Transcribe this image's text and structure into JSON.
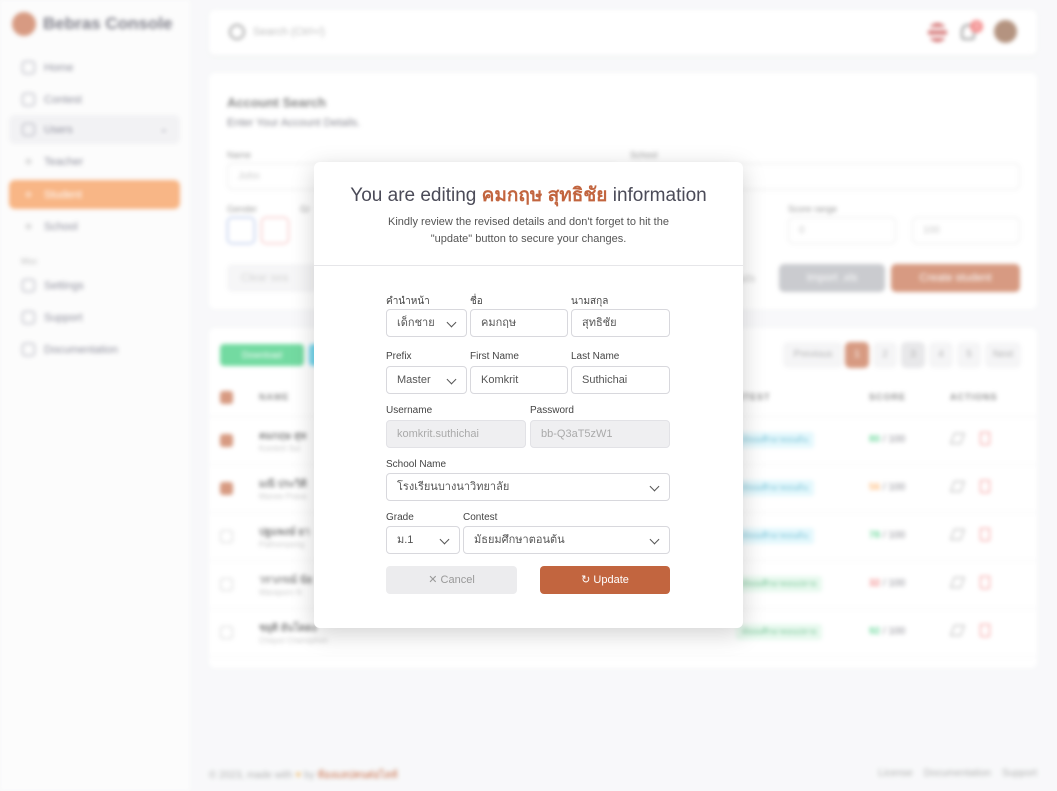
{
  "sidebar": {
    "brand": "Bebras Console",
    "items": [
      {
        "label": "Home",
        "icon": "home-icon"
      },
      {
        "label": "Contest",
        "icon": "chart-icon"
      },
      {
        "label": "Users",
        "icon": "users-icon"
      },
      {
        "label": "Teacher",
        "icon": "dot-icon"
      },
      {
        "label": "Student",
        "icon": "dot-icon"
      },
      {
        "label": "School",
        "icon": "dot-icon"
      },
      {
        "label": "Settings",
        "icon": "gear-icon"
      },
      {
        "label": "Support",
        "icon": "headset-icon"
      },
      {
        "label": "Documentation",
        "icon": "document-icon"
      }
    ],
    "section_misc": "Misc"
  },
  "topbar": {
    "search_placeholder": "Search (Ctrl+/)",
    "notification_count": "3"
  },
  "search_card": {
    "title": "Account Search",
    "subtitle": "Enter Your Account Details.",
    "name_label": "Name",
    "name_placeholder": "John",
    "school_label": "School",
    "gender_label": "Gender",
    "grade_label": "Gr",
    "score_label": "Score range",
    "score_min": "0",
    "score_max": "100",
    "clear_label": "Clear sea",
    "import_label": "Import .xls",
    "create_label": "Create student",
    "hidden_label": "ails"
  },
  "table_card": {
    "download_label": "Download",
    "pages": [
      "Previous",
      "1",
      "2",
      "3",
      "4",
      "5",
      "Next"
    ],
    "headers": {
      "name": "NAME",
      "contest": "NTEST",
      "score": "SCORE",
      "actions": "ACTIONS"
    },
    "rows": [
      {
        "name": "คมกฤษ สุท",
        "sub": "Komkrit Sut",
        "contest": "มัธยมศึกษาตอนต้น",
        "score": "80",
        "max": "/ 100",
        "checked": true
      },
      {
        "name": "มณี ประวิติ",
        "sub": "Manee Prava",
        "contest": "มัธยมศึกษาตอนต้น",
        "score": "56",
        "max": "/ 100",
        "checked": true
      },
      {
        "name": "ปฐมพงษ์ ยา",
        "sub": "Pathompong",
        "contest": "มัธยมศึกษาตอนต้น",
        "score": "78",
        "max": "/ 100",
        "checked": false
      },
      {
        "name": "วราภรณ์ นัธ",
        "sub": "Waraporn N",
        "contest": "มัธยมศึกษาตอนปลาย",
        "score": "32",
        "max": "/ 100",
        "checked": false
      },
      {
        "name": "ชยุติ ยันโตดง",
        "sub": "Chayut Chanophon",
        "contest": "มัธยมศึกษาตอนปลาย",
        "score": "92",
        "max": "/ 100",
        "checked": false
      }
    ]
  },
  "footer": {
    "copyright": "© 2023, made with",
    "by": "by",
    "author": "ห้องแลปคนต่อไลท์",
    "links": [
      "License",
      "Documentation",
      "Support"
    ]
  },
  "modal": {
    "title_prefix": "You are editing",
    "title_name": "คมกฤษ สุทธิชัย",
    "title_suffix": "information",
    "description": "Kindly review the revised details and don't forget to hit the \"update\" button to secure your changes.",
    "thai_prefix_label": "คำนำหน้า",
    "thai_prefix_value": "เด็กชาย",
    "thai_first_label": "ชื่อ",
    "thai_first_value": "คมกฤษ",
    "thai_last_label": "นามสกุล",
    "thai_last_value": "สุทธิชัย",
    "prefix_label": "Prefix",
    "prefix_value": "Master",
    "first_label": "First Name",
    "first_value": "Komkrit",
    "last_label": "Last Name",
    "last_value": "Suthichai",
    "username_label": "Username",
    "username_value": "komkrit.suthichai",
    "password_label": "Password",
    "password_value": "bb-Q3aT5zW1",
    "school_label": "School Name",
    "school_value": "โรงเรียนบางนาวิทยาลัย",
    "grade_label": "Grade",
    "grade_value": "ม.1",
    "contest_label": "Contest",
    "contest_value": "มัธยมศึกษาตอนต้น",
    "cancel_label": "Cancel",
    "update_label": "Update"
  },
  "colors": {
    "accent": "#c2653f",
    "sidebar_active": "#f58f45",
    "success": "#28c76f"
  }
}
